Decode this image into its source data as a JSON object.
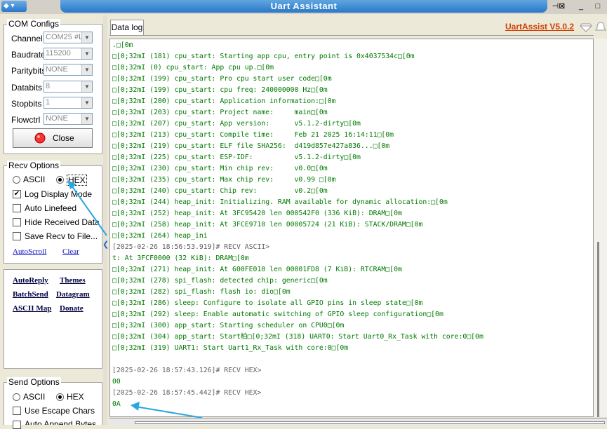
{
  "window": {
    "title": "Uart Assistant",
    "sysmenu": "◆ ▾",
    "pin": "⊣⊠",
    "minimize": "_",
    "maximize": "□"
  },
  "com_configs": {
    "title": "COM Configs",
    "fields": [
      {
        "label": "Channel",
        "value": "COM25 #L"
      },
      {
        "label": "Baudrate",
        "value": "115200"
      },
      {
        "label": "Paritybits",
        "value": "NONE"
      },
      {
        "label": "Databits",
        "value": "8"
      },
      {
        "label": "Stopbits",
        "value": "1"
      },
      {
        "label": "Flowctrl",
        "value": "NONE"
      }
    ],
    "close_label": "Close"
  },
  "recv_options": {
    "title": "Recv Options",
    "ascii": "ASCII",
    "hex": "HEX",
    "log_display": "Log Display Mode",
    "auto_linefeed": "Auto Linefeed",
    "hide_received": "Hide Received Data",
    "save_recv": "Save Recv to File...",
    "autoscroll": "AutoScroll",
    "clear": "Clear"
  },
  "links": {
    "autoreply": "AutoReply",
    "themes": "Themes",
    "batchsend": "BatchSend",
    "datagram": "Datagram",
    "ascii_map": "ASCII Map",
    "donate": "Donate"
  },
  "send_options": {
    "title": "Send Options",
    "ascii": "ASCII",
    "hex": "HEX",
    "escape": "Use Escape Chars",
    "auto_append": "Auto Append Bytes"
  },
  "tab": {
    "label": "Data log"
  },
  "brand": {
    "label": "UartAssist V5.0.2"
  },
  "colors": {
    "accent": "#2a78c8",
    "green_log": "#007a00",
    "gray_log": "#606060",
    "arrow": "#2aa6e0",
    "brand": "#d04000"
  },
  "log_lines": [
    {
      "text": ".□[0m",
      "color": "#007a00"
    },
    {
      "text": "□[0;32mI (181) cpu_start: Starting app cpu, entry point is 0x4037534c□[0m",
      "color": "#007a00"
    },
    {
      "text": "□[0;32mI (0) cpu_start: App cpu up.□[0m",
      "color": "#007a00"
    },
    {
      "text": "□[0;32mI (199) cpu_start: Pro cpu start user code□[0m",
      "color": "#007a00"
    },
    {
      "text": "□[0;32mI (199) cpu_start: cpu freq: 240000000 Hz□[0m",
      "color": "#007a00"
    },
    {
      "text": "□[0;32mI (200) cpu_start: Application information:□[0m",
      "color": "#007a00"
    },
    {
      "text": "□[0;32mI (203) cpu_start: Project name:     main□[0m",
      "color": "#007a00"
    },
    {
      "text": "□[0;32mI (207) cpu_start: App version:      v5.1.2-dirty□[0m",
      "color": "#007a00"
    },
    {
      "text": "□[0;32mI (213) cpu_start: Compile time:     Feb 21 2025 16:14:11□[0m",
      "color": "#007a00"
    },
    {
      "text": "□[0;32mI (219) cpu_start: ELF file SHA256:  d419d857e427a836...□[0m",
      "color": "#007a00"
    },
    {
      "text": "□[0;32mI (225) cpu_start: ESP-IDF:          v5.1.2-dirty□[0m",
      "color": "#007a00"
    },
    {
      "text": "□[0;32mI (230) cpu_start: Min chip rev:     v0.0□[0m",
      "color": "#007a00"
    },
    {
      "text": "□[0;32mI (235) cpu_start: Max chip rev:     v0.99 □[0m",
      "color": "#007a00"
    },
    {
      "text": "□[0;32mI (240) cpu_start: Chip rev:         v0.2□[0m",
      "color": "#007a00"
    },
    {
      "text": "□[0;32mI (244) heap_init: Initializing. RAM available for dynamic allocation:□[0m",
      "color": "#007a00"
    },
    {
      "text": "□[0;32mI (252) heap_init: At 3FC95420 len 000542F0 (336 KiB): DRAM□[0m",
      "color": "#007a00"
    },
    {
      "text": "□[0;32mI (258) heap_init: At 3FCE9710 len 00005724 (21 KiB): STACK/DRAM□[0m",
      "color": "#007a00"
    },
    {
      "text": "□[0;32mI (264) heap_ini",
      "color": "#007a00"
    },
    {
      "text": "[2025-02-26 18:56:53.919]# RECV ASCII>",
      "color": "#606060"
    },
    {
      "text": "t: At 3FCF0000 (32 KiB): DRAM□[0m",
      "color": "#007a00"
    },
    {
      "text": "□[0;32mI (271) heap_init: At 600FE010 len 00001FD8 (7 KiB): RTCRAM□[0m",
      "color": "#007a00"
    },
    {
      "text": "□[0;32mI (278) spi_flash: detected chip: generic□[0m",
      "color": "#007a00"
    },
    {
      "text": "□[0;32mI (282) spi_flash: flash io: dio□[0m",
      "color": "#007a00"
    },
    {
      "text": "□[0;32mI (286) sleep: Configure to isolate all GPIO pins in sleep state□[0m",
      "color": "#007a00"
    },
    {
      "text": "□[0;32mI (292) sleep: Enable automatic switching of GPIO sleep configuration□[0m",
      "color": "#007a00"
    },
    {
      "text": "□[0;32mI (300) app_start: Starting scheduler on CPU0□[0m",
      "color": "#007a00"
    },
    {
      "text": "□[0;32mI (304) app_start: Start柏□[0;32mI (318) UART0: Start Uart0_Rx_Task with core:0□[0m",
      "color": "#007a00"
    },
    {
      "text": "□[0;32mI (319) UART1: Start Uart1_Rx_Task with core:0□[0m",
      "color": "#007a00"
    },
    {
      "text": "",
      "color": "#007a00"
    },
    {
      "text": "[2025-02-26 18:57:43.126]# RECV HEX>",
      "color": "#606060"
    },
    {
      "text": "00",
      "color": "#007a00"
    },
    {
      "text": "[2025-02-26 18:57:45.442]# RECV HEX>",
      "color": "#606060"
    },
    {
      "text": "0A",
      "color": "#007a00"
    }
  ]
}
